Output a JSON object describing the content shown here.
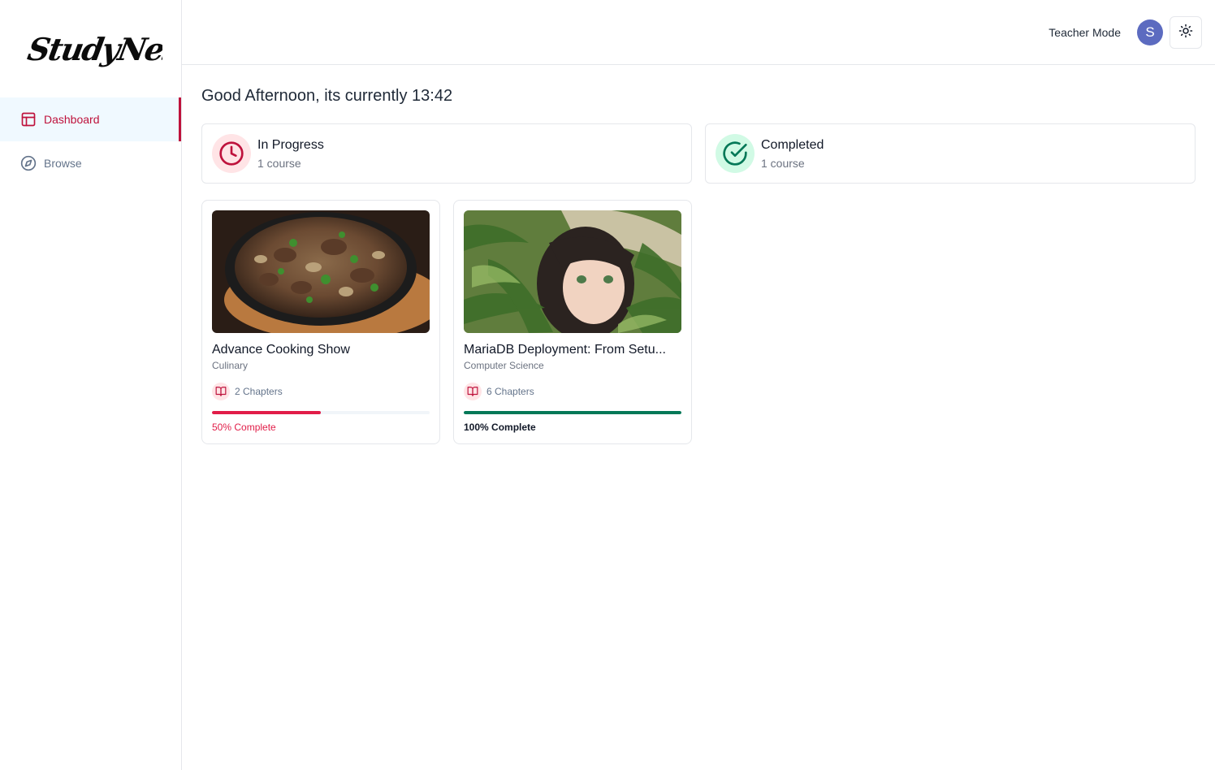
{
  "brand": {
    "logo_text": "StudyNest"
  },
  "sidebar": {
    "items": [
      {
        "label": "Dashboard",
        "icon": "layout-icon",
        "active": true
      },
      {
        "label": "Browse",
        "icon": "compass-icon",
        "active": false
      }
    ]
  },
  "header": {
    "teacher_mode_label": "Teacher Mode",
    "avatar_initial": "S",
    "theme_icon": "sun-icon"
  },
  "greeting": "Good Afternoon, its currently 13:42",
  "stats": {
    "in_progress": {
      "title": "In Progress",
      "count": "1 course",
      "icon": "clock-icon",
      "color": "#be123c"
    },
    "completed": {
      "title": "Completed",
      "count": "1 course",
      "icon": "check-circle-icon",
      "color": "#047857"
    }
  },
  "courses": [
    {
      "title": "Advance Cooking Show",
      "category": "Culinary",
      "chapters": "2 Chapters",
      "progress": 50,
      "progress_label": "50% Complete",
      "color": "#e11d48"
    },
    {
      "title": "MariaDB Deployment: From Setu...",
      "category": "Computer Science",
      "chapters": "6 Chapters",
      "progress": 100,
      "progress_label": "100% Complete",
      "color": "#047857"
    }
  ]
}
